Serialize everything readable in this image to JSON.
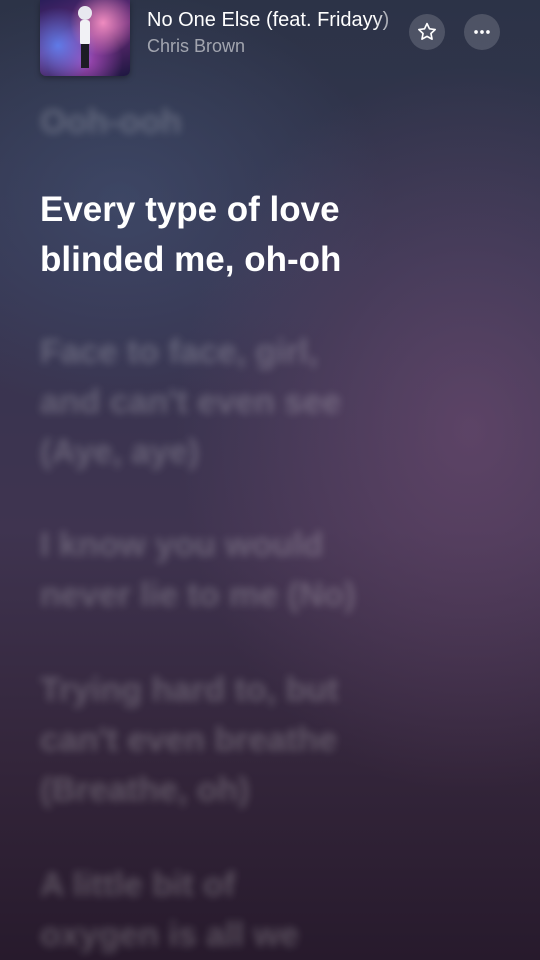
{
  "now_playing": {
    "title": "No One Else (feat. Fridayy)",
    "artist": "Chris Brown"
  },
  "buttons": {
    "favorite_icon": "star-icon",
    "more_icon": "ellipsis-icon"
  },
  "lyrics": {
    "previous": "Ooh-ooh",
    "current": "Every type of love\nblinded me, oh-oh",
    "upcoming": [
      "Face to face, girl,\nand can't even see\n(Aye, aye)",
      "I know you would\nnever lie to me (No)",
      "Trying hard to, but\ncan't even breathe\n(Breathe, oh)",
      "A little bit of\noxygen is all we"
    ]
  }
}
